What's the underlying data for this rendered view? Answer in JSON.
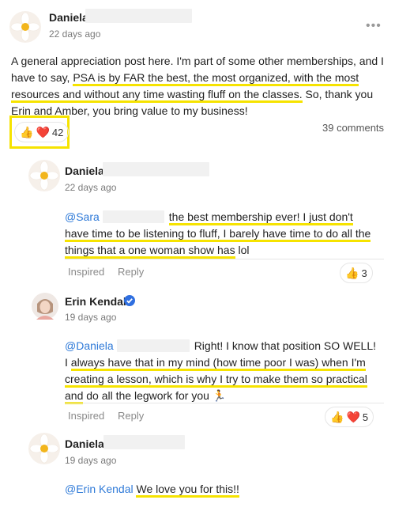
{
  "post": {
    "author": "Daniela",
    "time": "22 days ago",
    "more_icon": "ellipsis-icon",
    "text_parts": {
      "p1": "A general appreciation post here. I'm part of some other memberships, and I have to say, ",
      "h1": "PSA is by FAR the best, the most organized, with the most resources and without any time wasting fluff on the classes.",
      "p2": " So, thank you Erin and Amber, you bring value to my business!"
    },
    "reaction_count": "42",
    "comments_count": "39 comments"
  },
  "comments": [
    {
      "author": "Daniela",
      "time": "22 days ago",
      "mention": "@Sara",
      "text_hl": "the best membership ever! I just don't have time to be listening to fluff, I barely have time to do all the things that a one woman show has",
      "text_tail": " lol",
      "inspired_label": "Inspired",
      "reply_label": "Reply",
      "reaction_count": "3"
    },
    {
      "author": "Erin Kendal",
      "time": "19 days ago",
      "mention": "@Daniela",
      "text_a": "Right! I know that position SO WELL! I ",
      "text_hl": "always have that in my mind (how time poor I was) when I'm creating a lesson, which is why I try to make them so practical and",
      "text_tail": " do all the legwork for you 🏃",
      "inspired_label": "Inspired",
      "reply_label": "Reply",
      "reaction_count": "5"
    },
    {
      "author": "Daniela",
      "time": "19 days ago",
      "mention": "@Erin Kendal",
      "text_hl": "We love you for this!!"
    }
  ],
  "colors": {
    "highlight": "#f6e300",
    "mention": "#2f7ad8",
    "verified": "#2f6fe0",
    "heart": "#e02424"
  }
}
